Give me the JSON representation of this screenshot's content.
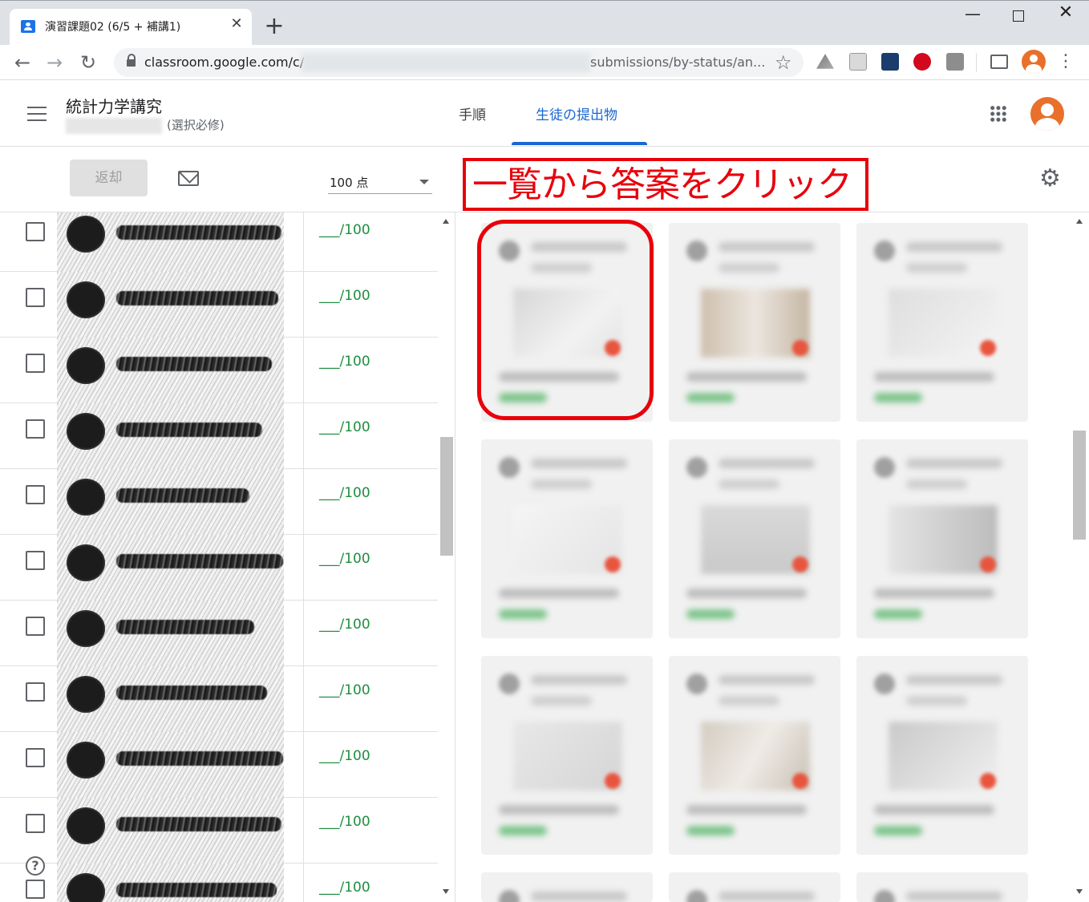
{
  "browser": {
    "tab_title": "演習課題02 (6/5 + 補講1)",
    "tab_close": "✕",
    "new_tab": "+",
    "window_controls": {
      "minimize": "—",
      "close": "✕"
    },
    "nav": {
      "back": "←",
      "forward": "→",
      "reload": "↻"
    },
    "url_prefix": "classroom.google.com/c/",
    "url_suffix": "submissions/by-status/an...",
    "bookmark_star": "☆",
    "extension_icons": [
      "drive-icon",
      "pdf-icon",
      "password-lock-icon",
      "trend-micro-icon",
      "puzzle-icon"
    ],
    "menu": "⋮"
  },
  "header": {
    "course_title": "統計力学講究",
    "course_section": "(選択必修)",
    "tabs": [
      {
        "label": "手順",
        "active": false
      },
      {
        "label": "生徒の提出物",
        "active": true
      }
    ]
  },
  "actions": {
    "return_label": "返却",
    "points_value": "100 点",
    "settings_icon": "⚙"
  },
  "annotation": {
    "text": "一覧から答案をクリック",
    "color": "#e8000b"
  },
  "students": [
    {
      "grade": "___/100"
    },
    {
      "grade": "___/100"
    },
    {
      "grade": "___/100"
    },
    {
      "grade": "___/100"
    },
    {
      "grade": "___/100"
    },
    {
      "grade": "___/100"
    },
    {
      "grade": "___/100"
    },
    {
      "grade": "___/100"
    },
    {
      "grade": "___/100"
    },
    {
      "grade": "___/100"
    },
    {
      "grade": "___/100"
    }
  ],
  "help_icon": "?",
  "colors": {
    "accent": "#1967d2",
    "grade_green": "#1e8e3e",
    "annotation_red": "#e8000b",
    "avatar_orange": "#e8702a"
  }
}
